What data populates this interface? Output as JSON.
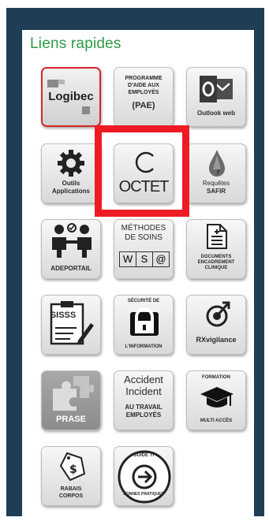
{
  "panel": {
    "title": "Liens rapides"
  },
  "tiles": {
    "logibec": {
      "label": "Logibec"
    },
    "pae": {
      "line1": "PROGRAMME",
      "line2": "D'AIDE AUX",
      "line3": "EMPLOYÉS",
      "line4": "(PAE)"
    },
    "outlook": {
      "label": "Outlook web"
    },
    "outils": {
      "line1": "Outils",
      "line2": "Applications"
    },
    "octet": {
      "label": "OCTET"
    },
    "safir": {
      "line1": "Requêtes",
      "line2": "SAFIR"
    },
    "adeportail": {
      "label": "ADEPORTAIL"
    },
    "methodes": {
      "line1": "MÉTHODES",
      "line2": "DE SOINS",
      "badge1": "W",
      "badge2": "S",
      "badge3": "@"
    },
    "documents": {
      "line1": "DOCUMENTS",
      "line2": "ENCADREMENT",
      "line3": "CLINIQUE"
    },
    "sisss": {
      "label": "SISSS"
    },
    "securite": {
      "top": "SÉCURITÉ DE",
      "bottom": "L'INFORMATION"
    },
    "rxvigilance": {
      "label": "RXvigilance"
    },
    "prase": {
      "label": "PRASE"
    },
    "accident": {
      "line1": "Accident",
      "line2": "Incident",
      "line3": "AU TRAVAIL",
      "line4": "EMPLOYÉS"
    },
    "formation": {
      "top": "FORMATION",
      "bottom": "MULTI ACCÈS"
    },
    "rabais": {
      "line1": "RABAIS",
      "line2": "CORPOS"
    },
    "guide": {
      "top": "GUIDE TI",
      "bottom": "BONNES PRATIQUES"
    }
  },
  "colors": {
    "frame": "#1f3d55",
    "title": "#2e9a47",
    "highlight": "#ee1b24",
    "logibec_border": "#d7262a"
  }
}
